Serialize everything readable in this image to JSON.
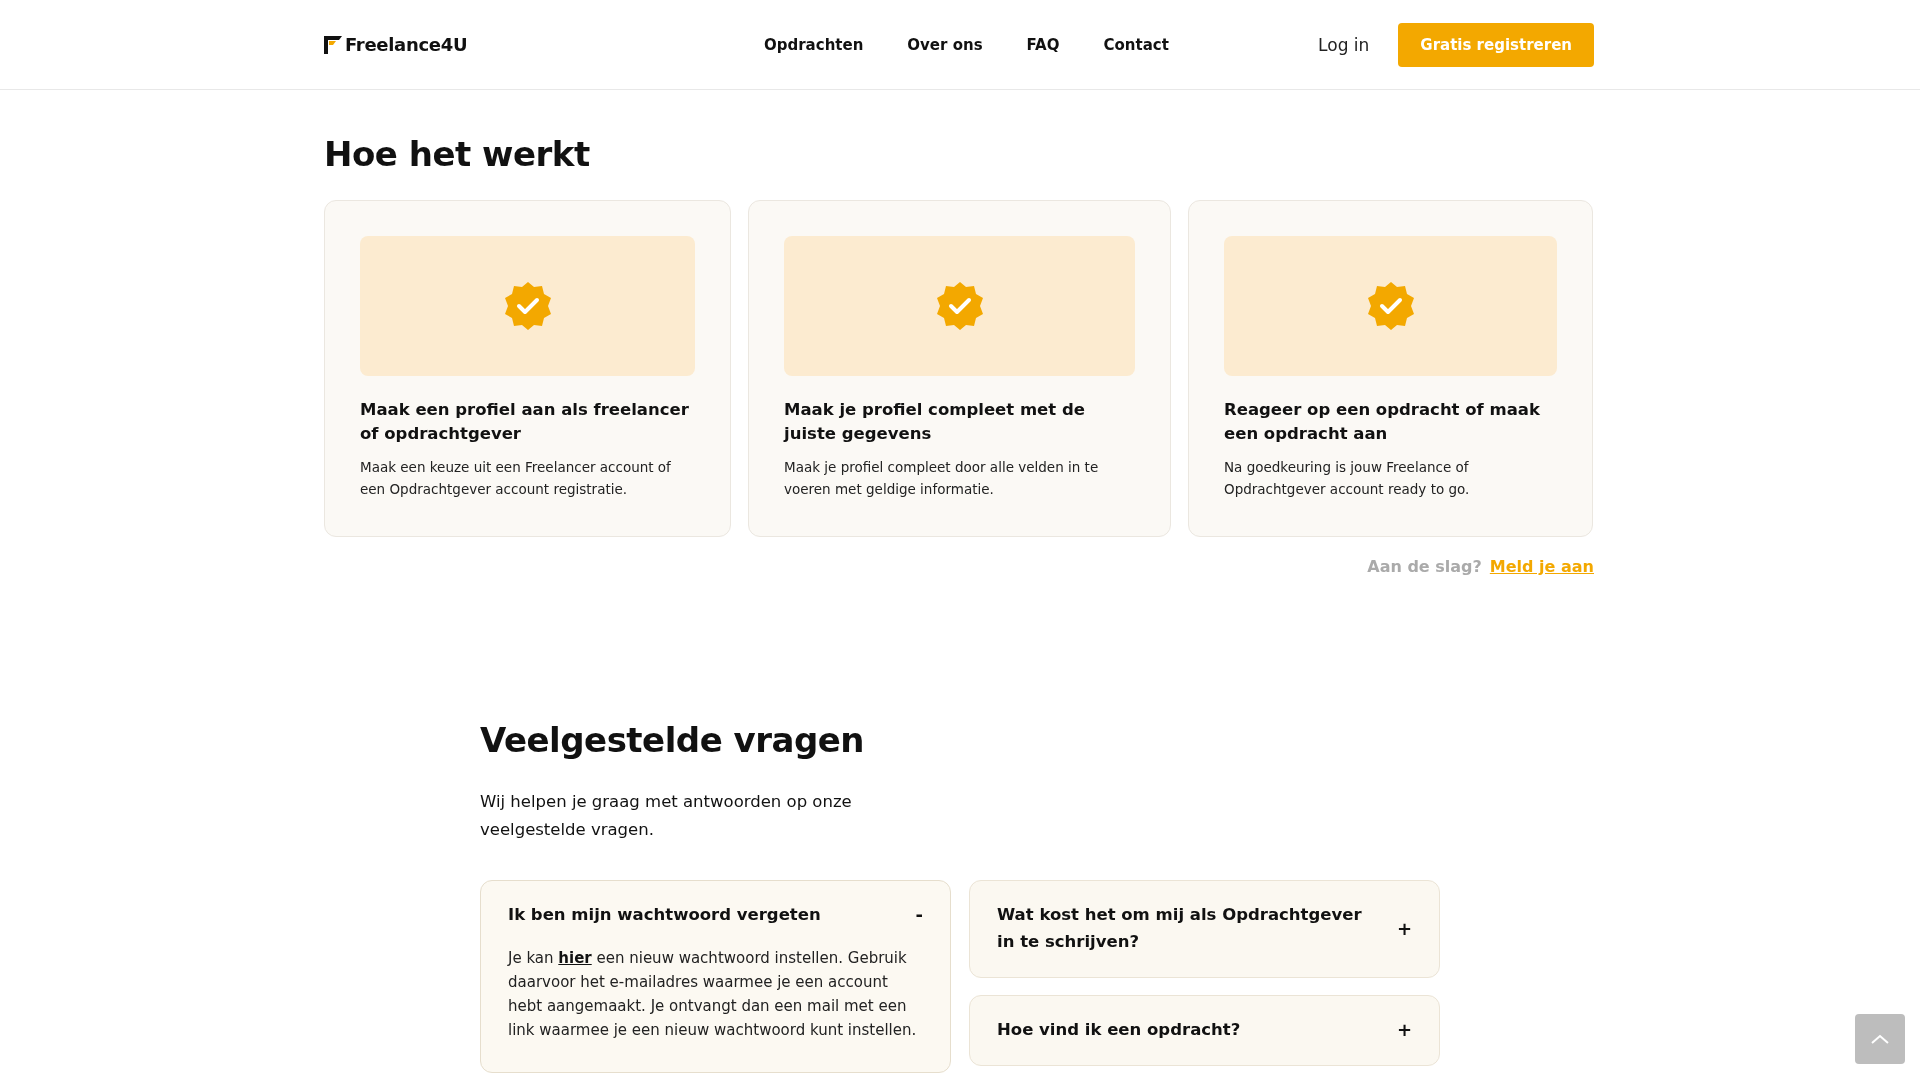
{
  "header": {
    "logo": "Freelance4U",
    "nav": [
      {
        "label": "Opdrachten"
      },
      {
        "label": "Over ons"
      },
      {
        "label": "FAQ"
      },
      {
        "label": "Contact"
      }
    ],
    "login": "Log in",
    "register": "Gratis registreren"
  },
  "how": {
    "title": "Hoe het werkt",
    "cards": [
      {
        "title": "Maak een profiel aan als freelancer of opdrachtgever",
        "text": "Maak een keuze uit een Freelancer account of een Opdrachtgever account registratie."
      },
      {
        "title": "Maak je profiel compleet met de juiste gegevens",
        "text": "Maak je profiel compleet door alle velden in te voeren met geldige informatie."
      },
      {
        "title": "Reageer op een opdracht of maak een opdracht aan",
        "text": "Na goedkeuring is jouw Freelance of Opdrachtgever account ready to go."
      }
    ],
    "cta_text": "Aan de slag?",
    "cta_link": "Meld je aan"
  },
  "faq": {
    "title": "Veelgestelde vragen",
    "intro": "Wij helpen je graag met antwoorden op onze veelgestelde vragen.",
    "columns": [
      [
        {
          "question": "Ik ben mijn wachtwoord vergeten",
          "toggle": "-",
          "expanded": true,
          "answer_before": "Je kan ",
          "answer_link": "hier",
          "answer_after": " een nieuw wachtwoord instellen. Gebruik daarvoor het e-mailadres waarmee je een account hebt aangemaakt. Je ontvangt dan een mail met een link waarmee je een nieuw wachtwoord kunt instellen."
        }
      ],
      [
        {
          "question": "Wat kost het om mij als Opdrachtgever in te schrijven?",
          "toggle": "+",
          "expanded": false
        },
        {
          "question": "Hoe vind ik een opdracht?",
          "toggle": "+",
          "expanded": false
        }
      ]
    ]
  }
}
